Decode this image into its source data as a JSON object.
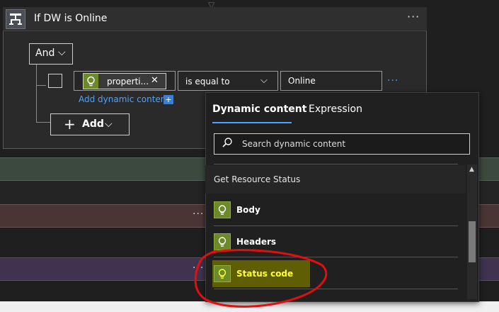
{
  "condition": {
    "title": "If DW is Online",
    "more": "···",
    "group_operator": "And",
    "rows": [
      {
        "left_token": "properti...",
        "operator": "is equal to",
        "right_value": "Online",
        "more": "···"
      }
    ],
    "add_dynamic_label": "Add dynamic content",
    "add_dynamic_plus": "+",
    "add_button_label": "Add"
  },
  "background": {
    "more1": "···",
    "more2": "···"
  },
  "dynamic_panel": {
    "tabs": [
      {
        "label": "Dynamic content",
        "active": true
      },
      {
        "label": "Expression",
        "active": false
      }
    ],
    "search_placeholder": "Search dynamic content",
    "group_label": "Get Resource Status",
    "items": [
      {
        "label": "Body",
        "icon": "lightbulb-icon"
      },
      {
        "label": "Headers",
        "icon": "lightbulb-icon"
      },
      {
        "label": "Status code",
        "icon": "lightbulb-icon",
        "highlighted": true
      }
    ]
  },
  "colors": {
    "accent": "#4aa3ff",
    "token_icon": "#6c8a2a",
    "highlight": "#6b6a00",
    "annotation": "#e01010"
  }
}
